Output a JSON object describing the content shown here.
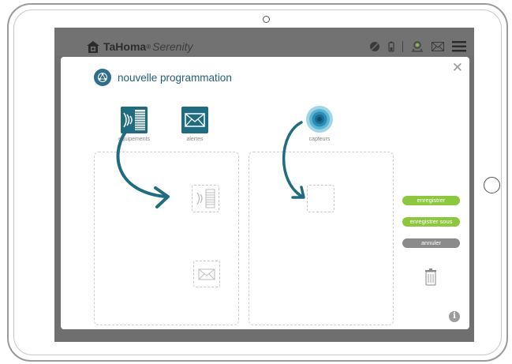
{
  "app": {
    "brand": "TaHoma",
    "reg": "®",
    "product": "Serenity"
  },
  "modal": {
    "title": "nouvelle programmation",
    "close_label": "✕",
    "tools": {
      "equipements": "equipements",
      "alertes": "alertes",
      "capteurs": "capteurs"
    },
    "buttons": {
      "save": "enregistrer",
      "save_as": "enregistrer sous",
      "cancel": "annuler"
    },
    "info_label": "i"
  },
  "colors": {
    "accent": "#2f6f8a",
    "arrow": "#1f6c80",
    "green": "#8dc63f",
    "grey_btn": "#8b8b8b",
    "overlay": "#6f6f6f"
  },
  "icons": [
    "house-icon",
    "no-camera-icon",
    "battery-icon",
    "alarm-icon",
    "envelope-icon",
    "menu-icon",
    "close-icon",
    "program-icon",
    "equipment-icon",
    "alert-envelope-icon",
    "sensor-icon",
    "trash-icon",
    "info-icon"
  ]
}
